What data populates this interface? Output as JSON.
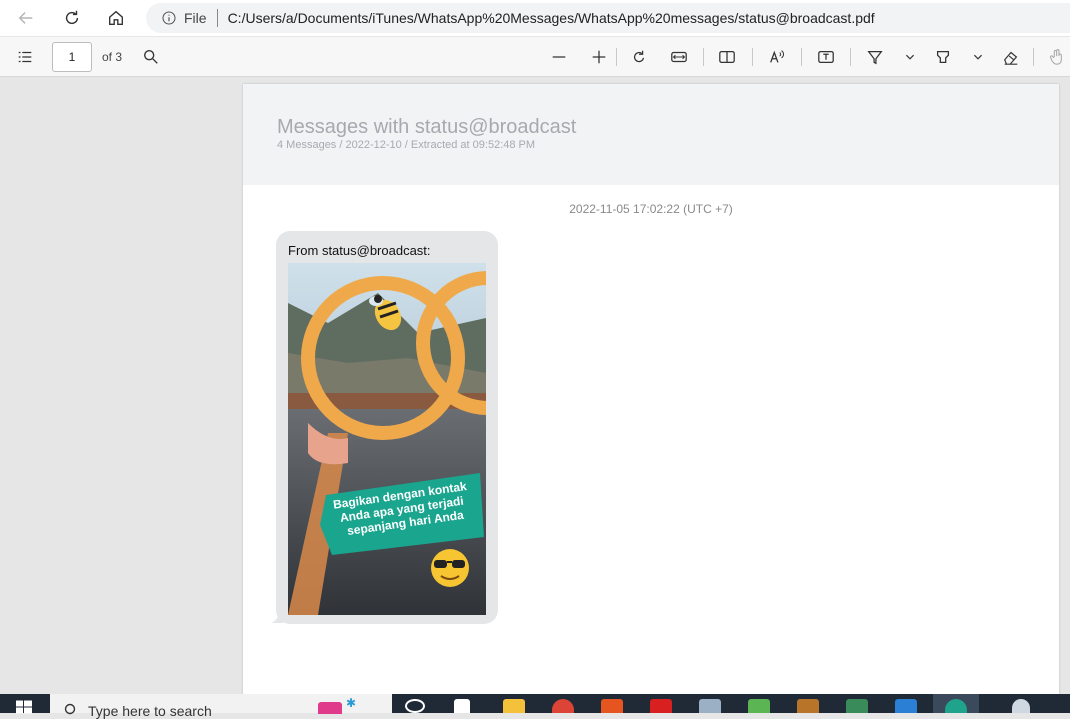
{
  "browser": {
    "url_scheme": "File",
    "url": "C:/Users/a/Documents/iTunes/WhatsApp%20Messages/WhatsApp%20messages/status@broadcast.pdf"
  },
  "pdf_toolbar": {
    "page_number": "1",
    "page_total": "of 3"
  },
  "document": {
    "title": "Messages with status@broadcast",
    "subtitle": "4 Messages / 2022-12-10 / Extracted at 09:52:48 PM",
    "message": {
      "timestamp": "2022-11-05 17:02:22 (UTC +7)",
      "from": "From status@broadcast:",
      "image_caption": [
        "Bagikan dengan kontak",
        "Anda apa yang terjadi",
        "sepanjang hari Anda"
      ]
    }
  },
  "taskbar": {
    "search_placeholder": "Type here to search"
  },
  "colors": {
    "header_bg": "#f2f3f4",
    "bubble_bg": "#e5e6e8",
    "accent_teal": "#1aa58f"
  }
}
